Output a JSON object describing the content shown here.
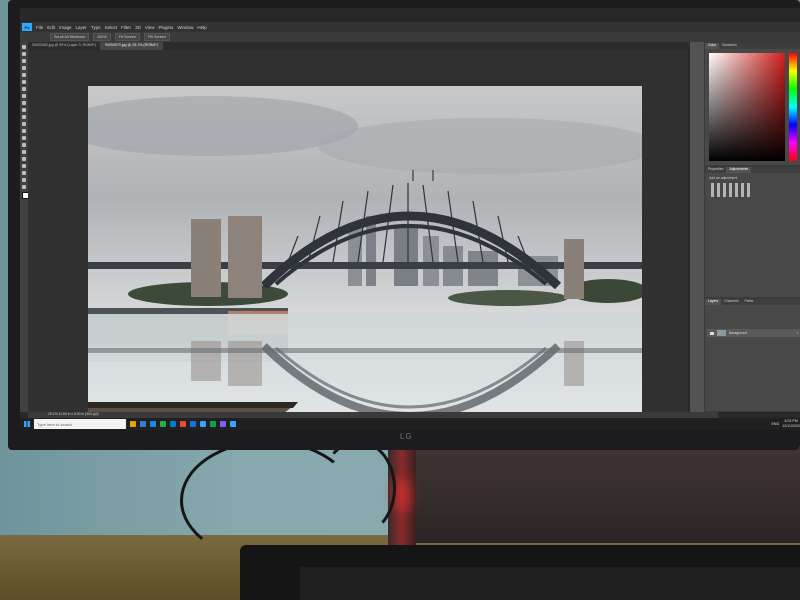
{
  "app": {
    "menu": [
      "File",
      "Edit",
      "Image",
      "Layer",
      "Type",
      "Select",
      "Filter",
      "3D",
      "View",
      "Plugins",
      "Window",
      "Help"
    ],
    "options_bar": [
      "Scroll All Windows",
      "100%",
      "Fit Screen",
      "Fill Screen"
    ],
    "tabs": [
      {
        "label": "SW00082.jpg @ 50% (Layer 0, RGB/8*)",
        "active": false
      },
      {
        "label": "SW00070.jpg @ 25.1% (RGB/8*)",
        "active": true
      }
    ],
    "panels": {
      "color_tabs": [
        "Color",
        "Swatches"
      ],
      "props_tabs": [
        "Properties",
        "Adjustments"
      ],
      "adjust_label": "Add an adjustment",
      "layer_tabs": [
        "Layers",
        "Channels",
        "Paths"
      ],
      "layer_name": "Background"
    },
    "status": "25.1%   11.60 in x 8.00 in (300 ppi)"
  },
  "taskbar": {
    "search_placeholder": "Type here to search",
    "time": "8:25 PM",
    "date": "12/11/2020",
    "lang": "ENG",
    "icon_colors": [
      "#e5a50a",
      "#3a7bd5",
      "#1e88e5",
      "#2eaa4a",
      "#0078d7",
      "#e94b3c",
      "#1473e6",
      "#31a8ff",
      "#0f9d58",
      "#7b61ff",
      "#31a8ff"
    ]
  },
  "brand": {
    "monitor_logo": "LG"
  },
  "colors": {
    "ps_accent": "#31a8ff",
    "taskbar": "#202020"
  }
}
